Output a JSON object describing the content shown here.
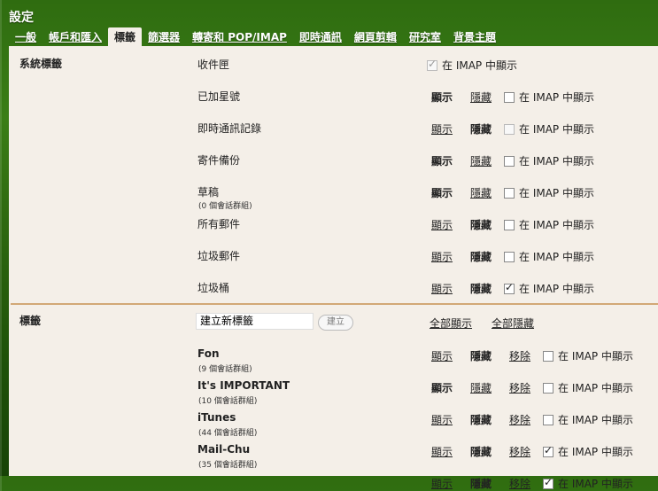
{
  "header": {
    "title": "設定",
    "tabs": [
      {
        "label": "一般",
        "active": false
      },
      {
        "label": "帳戶和匯入",
        "active": false
      },
      {
        "label": "標籤",
        "active": true
      },
      {
        "label": "篩選器",
        "active": false
      },
      {
        "label": "轉寄和 POP/IMAP",
        "active": false
      },
      {
        "label": "即時通訊",
        "active": false
      },
      {
        "label": "網頁剪輯",
        "active": false
      },
      {
        "label": "研究室",
        "active": false
      },
      {
        "label": "背景主題",
        "active": false
      }
    ]
  },
  "system_section": {
    "heading": "系統標籤",
    "labels": [
      {
        "name": "收件匣",
        "show": "",
        "hide": "",
        "imap": "在 IMAP 中顯示",
        "imap_checked": true,
        "imap_disabled": true
      },
      {
        "name": "已加星號",
        "show": "顯示",
        "hide": "隱藏",
        "imap": "在 IMAP 中顯示",
        "imap_checked": false,
        "state": "show"
      },
      {
        "name": "即時通訊記錄",
        "show": "顯示",
        "hide": "隱藏",
        "imap": "在 IMAP 中顯示",
        "imap_checked": false,
        "imap_disabled": true,
        "state": "hide"
      },
      {
        "name": "寄件備份",
        "show": "顯示",
        "hide": "隱藏",
        "imap": "在 IMAP 中顯示",
        "imap_checked": false,
        "state": "show"
      },
      {
        "name": "草稿",
        "count": "(0 個會話群組)",
        "show": "顯示",
        "hide": "隱藏",
        "imap": "在 IMAP 中顯示",
        "imap_checked": false,
        "state": "show"
      },
      {
        "name": "所有郵件",
        "show": "顯示",
        "hide": "隱藏",
        "imap": "在 IMAP 中顯示",
        "imap_checked": false,
        "state": "hide"
      },
      {
        "name": "垃圾郵件",
        "show": "顯示",
        "hide": "隱藏",
        "imap": "在 IMAP 中顯示",
        "imap_checked": false,
        "state": "hide"
      },
      {
        "name": "垃圾桶",
        "show": "顯示",
        "hide": "隱藏",
        "imap": "在 IMAP 中顯示",
        "imap_checked": true,
        "state": "hide"
      }
    ]
  },
  "user_section": {
    "heading": "標籤",
    "new_label_value": "建立新標籤",
    "create_button": "建立",
    "show_all": "全部顯示",
    "hide_all": "全部隱藏",
    "labels": [
      {
        "name": "Fon",
        "count": "(9 個會話群組)",
        "show": "顯示",
        "hide": "隱藏",
        "remove": "移除",
        "imap": "在 IMAP 中顯示",
        "imap_checked": false,
        "state": "hide"
      },
      {
        "name": "It's IMPORTANT",
        "count": "(10 個會話群組)",
        "show": "顯示",
        "hide": "隱藏",
        "remove": "移除",
        "imap": "在 IMAP 中顯示",
        "imap_checked": false,
        "state": "show"
      },
      {
        "name": "iTunes",
        "count": "(44 個會話群組)",
        "show": "顯示",
        "hide": "隱藏",
        "remove": "移除",
        "imap": "在 IMAP 中顯示",
        "imap_checked": false,
        "state": "hide"
      },
      {
        "name": "Mail-Chu",
        "count": "(35 個會話群組)",
        "show": "顯示",
        "hide": "隱藏",
        "remove": "移除",
        "imap": "在 IMAP 中顯示",
        "imap_checked": true,
        "state": "hide"
      },
      {
        "name": "",
        "show": "顯示",
        "hide": "隱藏",
        "remove": "移除",
        "imap": "在 IMAP 中顯示",
        "imap_checked": true,
        "state": "hide"
      }
    ]
  },
  "colors": {
    "panel": "#f4efe8",
    "divider": "#d2a876",
    "header_green": "#2f6c10"
  }
}
